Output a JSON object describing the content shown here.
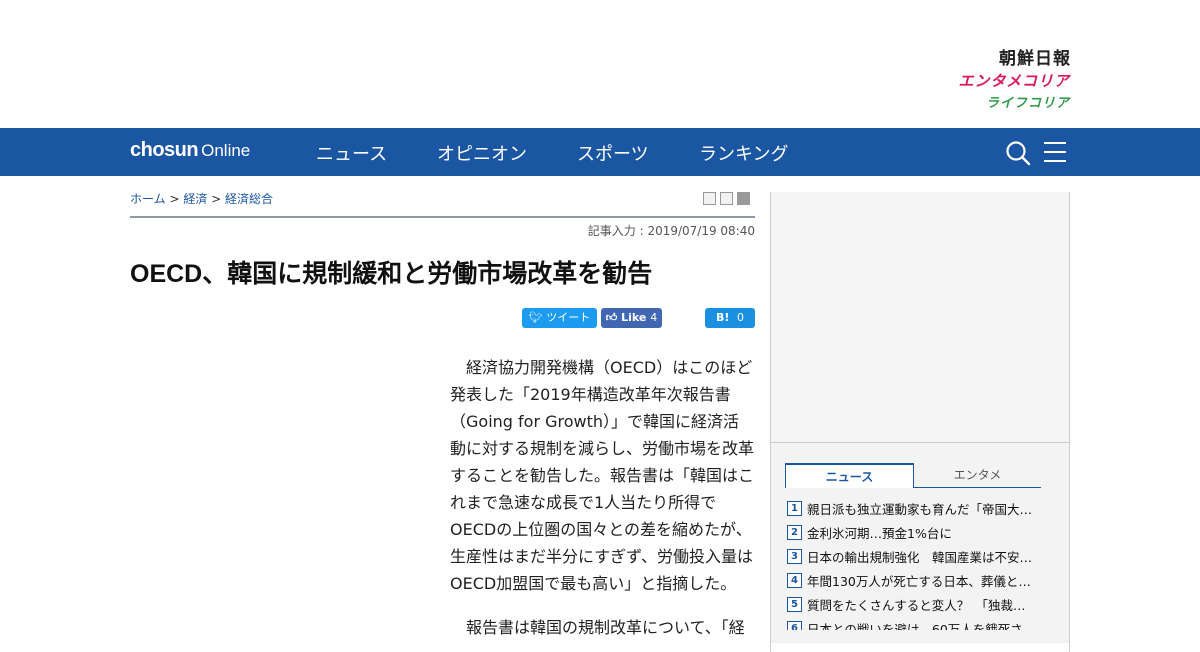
{
  "logos": {
    "chosun": "朝鮮日報",
    "enta": "エンタメコリア",
    "life": "ライフコリア"
  },
  "nav": {
    "brand_bold": "chosun",
    "brand_light": "Online",
    "items": [
      {
        "label": "ニュース"
      },
      {
        "label": "オピニオン"
      },
      {
        "label": "スポーツ"
      },
      {
        "label": "ランキング"
      }
    ]
  },
  "breadcrumb": {
    "home": "ホーム",
    "sep": " > ",
    "level1": "経済",
    "level2": "経済総合"
  },
  "article": {
    "date": "記事入力 : 2019/07/19 08:40",
    "title": "OECD、韓国に規制緩和と労働市場改革を勧告",
    "share": {
      "tweet": "ツイート",
      "like": "Like",
      "like_count": "4",
      "hatena": "B!",
      "hatena_count": "0"
    },
    "p1": "　経済協力開発機構（OECD）はこのほど発表した「2019年構造改革年次報告書（Going for Growth）」で韓国に経済活動に対する規制を減らし、労働市場を改革することを勧告した。報告書は「韓国はこれまで急速な成長で1人当たり所得でOECDの上位圏の国々との差を縮めたが、生産性はまだ半分にすぎず、労働投入量はOECD加盟国で最も高い」と指摘した。",
    "p2": "　報告書は韓国の規制改革について、「経"
  },
  "sidebar": {
    "tabs": {
      "news": "ニュース",
      "enta": "エンタメ"
    },
    "ranking": [
      {
        "num": "1",
        "title": "親日派も独立運動家も育んだ「帝国大…"
      },
      {
        "num": "2",
        "title": "金利氷河期…預金1%台に"
      },
      {
        "num": "3",
        "title": "日本の輸出規制強化　韓国産業は不安…"
      },
      {
        "num": "4",
        "title": "年間130万人が死亡する日本、葬儀と…"
      },
      {
        "num": "5",
        "title": "質問をたくさんすると変人？　「独裁…"
      },
      {
        "num": "6",
        "title": "日本との戦いを避け　60万人を餓死さ…"
      }
    ]
  },
  "colors": {
    "nav_bg": "#1b56a3",
    "enta_logo": "#d6195c",
    "life_logo": "#2e9a4a",
    "twitter": "#1d9bf0",
    "facebook": "#4267b2",
    "hatena": "#1b8fe0"
  }
}
